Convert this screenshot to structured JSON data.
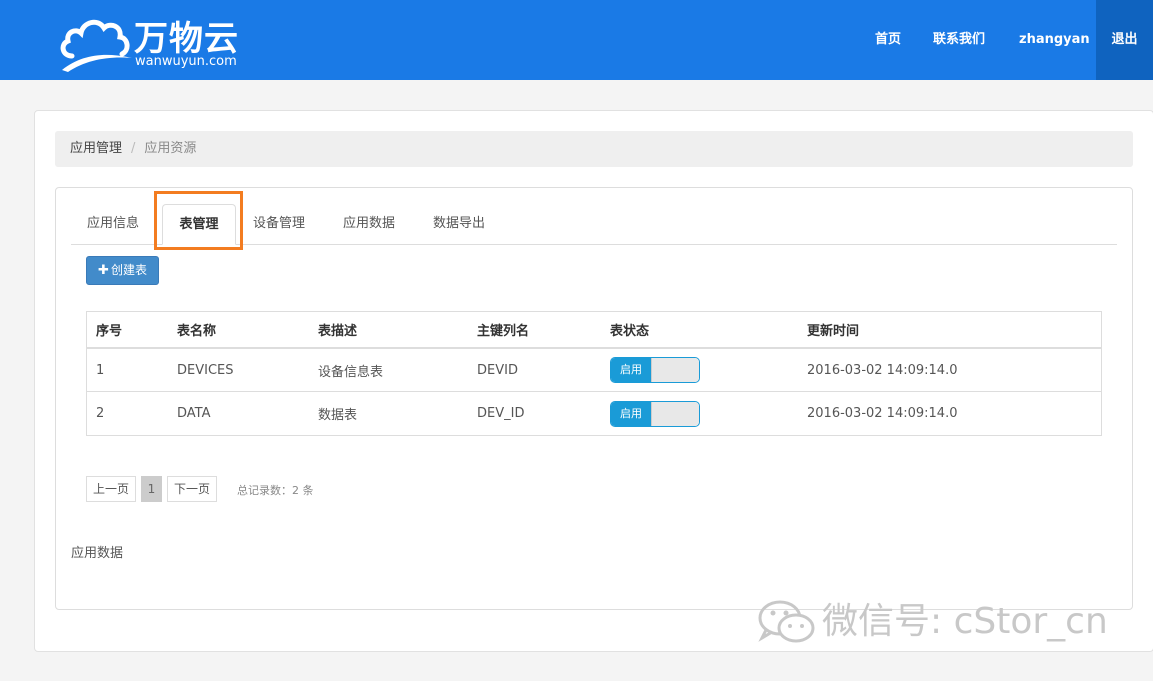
{
  "header": {
    "logo_main": "万物云",
    "logo_sub": "wanwuyun.com",
    "nav": {
      "home": "首页",
      "contact": "联系我们",
      "user": "zhangyan",
      "logout": "退出"
    },
    "brand_color": "#1a7ae6"
  },
  "breadcrumb": {
    "items": [
      "应用管理",
      "应用资源"
    ],
    "separator": "/"
  },
  "tabs": [
    {
      "label": "应用信息",
      "active": false
    },
    {
      "label": "表管理",
      "active": true
    },
    {
      "label": "设备管理",
      "active": false
    },
    {
      "label": "应用数据",
      "active": false
    },
    {
      "label": "数据导出",
      "active": false
    }
  ],
  "toolbar": {
    "create_label": "创建表",
    "create_icon": "plus-icon"
  },
  "table": {
    "columns": [
      "序号",
      "表名称",
      "表描述",
      "主键列名",
      "表状态",
      "更新时间"
    ],
    "rows": [
      {
        "index": "1",
        "name": "DEVICES",
        "description": "设备信息表",
        "primary_key": "DEVID",
        "status": "启用",
        "updated": "2016-03-02 14:09:14.0"
      },
      {
        "index": "2",
        "name": "DATA",
        "description": "数据表",
        "primary_key": "DEV_ID",
        "status": "启用",
        "updated": "2016-03-02 14:09:14.0"
      }
    ]
  },
  "pagination": {
    "prev": "上一页",
    "current": "1",
    "next": "下一页",
    "total": "总记录数：2 条"
  },
  "section_title": "应用数据",
  "watermark": {
    "text": "微信号: cStor_cn",
    "icon": "wechat-icon"
  },
  "colors": {
    "accent": "#f37c20",
    "switch_on": "#1a9bd7",
    "button": "#428bca"
  }
}
